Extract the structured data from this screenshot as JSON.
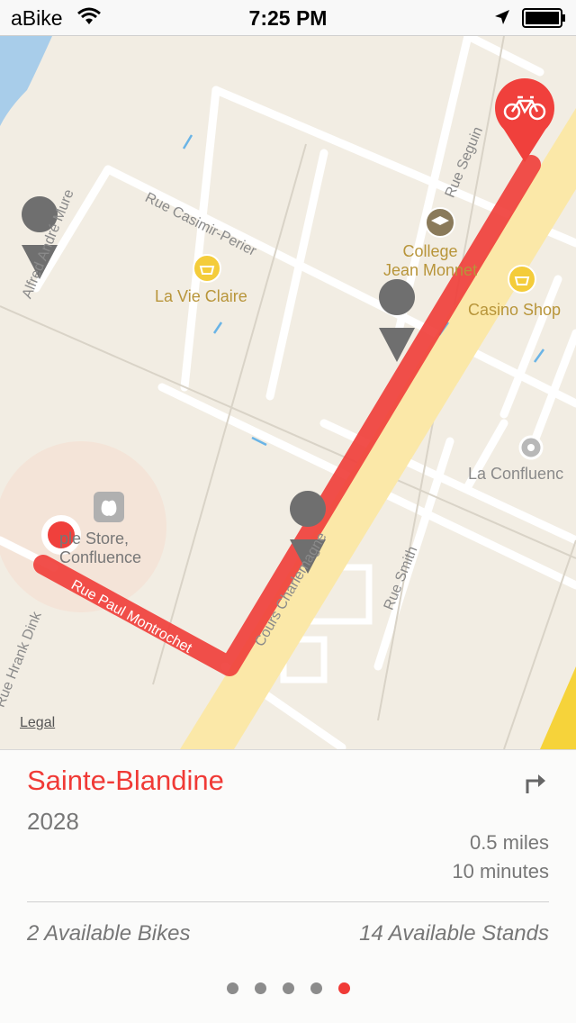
{
  "status_bar": {
    "carrier": "aBike",
    "time": "7:25 PM"
  },
  "map": {
    "legal_label": "Legal",
    "pois": [
      {
        "label": "La Vie Claire",
        "icon": "basket-icon"
      },
      {
        "label": "College\nJean Monnet",
        "icon": "graduation-cap-icon"
      },
      {
        "label": "Casino Shop",
        "icon": "basket-icon"
      },
      {
        "label": "La Confluenc",
        "icon": "circle-icon"
      },
      {
        "label": "ple Store,\nConfluence",
        "icon": "apple-icon"
      }
    ],
    "streets": [
      "Rue Casimir-Perier",
      "Rue Seguin",
      "Rue Paul Montrochet",
      "Cours Charlemagne",
      "Rue Smith",
      "Alfred André Mure",
      "Rue Hrank Dink"
    ],
    "route_color": "#f0403c",
    "destination_icon": "bicycle-icon"
  },
  "station": {
    "name": "Sainte-Blandine",
    "id": "2028",
    "distance": "0.5 miles",
    "duration": "10 minutes",
    "available_bikes": "2 Available Bikes",
    "available_stands": "14 Available Stands"
  },
  "pager": {
    "count": 5,
    "active_index": 4
  },
  "colors": {
    "accent": "#f03a36"
  }
}
